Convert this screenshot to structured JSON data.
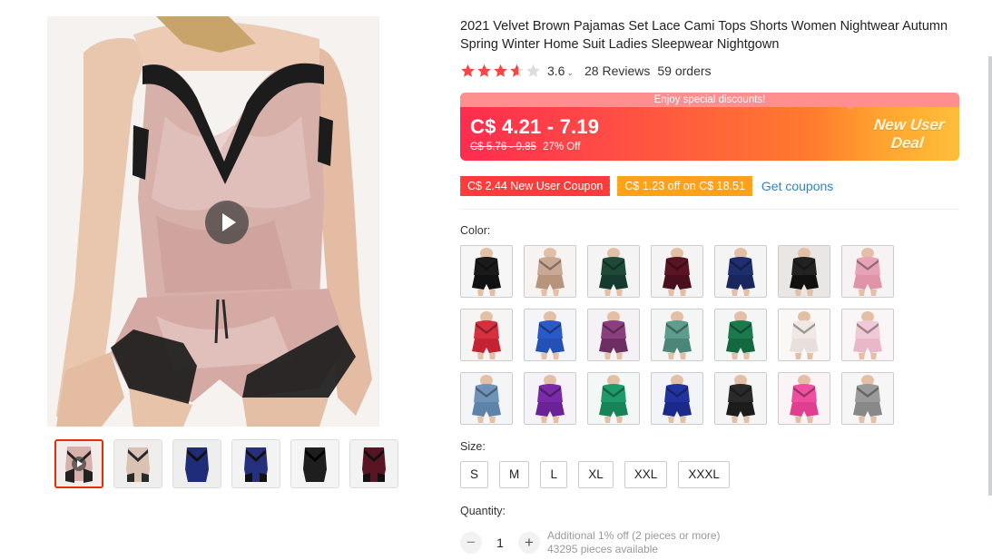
{
  "product": {
    "title": "2021 Velvet Brown Pajamas Set Lace Cami Tops Shorts Women Nightwear Autumn Spring Winter Home Suit Ladies Sleepwear Nightgown",
    "rating": {
      "value": "3.6",
      "stars": 3.6,
      "reviews": "28 Reviews",
      "orders": "59 orders"
    }
  },
  "price": {
    "banner": "Enjoy special discounts!",
    "range": "C$ 4.21 - 7.19",
    "original": "C$ 5.76 - 9.85",
    "discount": "27% Off",
    "deal_line1": "New User",
    "deal_line2": "Deal"
  },
  "coupons": {
    "new_user": "C$ 2.44 New User Coupon",
    "store": "C$ 1.23 off on C$ 18.51",
    "get": "Get coupons"
  },
  "color": {
    "label": "Color:",
    "swatches": [
      {
        "name": "black",
        "top": "#1a1a1a",
        "bottom": "#111111",
        "bg": "#f6f6f6"
      },
      {
        "name": "champagne",
        "top": "#c9a995",
        "bottom": "#b8947c",
        "bg": "#f6f3f0"
      },
      {
        "name": "dark-green",
        "top": "#1f4a3a",
        "bottom": "#163a2d",
        "bg": "#f4f4f4"
      },
      {
        "name": "wine",
        "top": "#5a1524",
        "bottom": "#4a0f1c",
        "bg": "#f4f4f4"
      },
      {
        "name": "navy",
        "top": "#1e2f6e",
        "bottom": "#18285e",
        "bg": "#f4f4f4"
      },
      {
        "name": "black-lace",
        "top": "#222222",
        "bottom": "#111111",
        "bg": "#e9e6e4"
      },
      {
        "name": "pink",
        "top": "#e7a4b6",
        "bottom": "#e094a8",
        "bg": "#f7f2f3"
      },
      {
        "name": "red",
        "top": "#d6303f",
        "bottom": "#c42334",
        "bg": "#f7f4f4"
      },
      {
        "name": "royal-blue",
        "top": "#2a5ac8",
        "bottom": "#2351b5",
        "bg": "#f4f5f8"
      },
      {
        "name": "purple-print",
        "top": "#8c3f7e",
        "bottom": "#6d2f63",
        "bg": "#f4f2f4"
      },
      {
        "name": "teal-print",
        "top": "#5e9c8e",
        "bottom": "#4c8678",
        "bg": "#f4f6f5"
      },
      {
        "name": "emerald",
        "top": "#1a7a4d",
        "bottom": "#146840",
        "bg": "#f4f6f5"
      },
      {
        "name": "white-print",
        "top": "#efe8e4",
        "bottom": "#e8dfdc",
        "bg": "#faf8f7"
      },
      {
        "name": "light-pink",
        "top": "#f0c9d6",
        "bottom": "#e8b8c8",
        "bg": "#faf6f7"
      },
      {
        "name": "steel-blue",
        "top": "#6f94b8",
        "bottom": "#5d83a8",
        "bg": "#f3f5f7"
      },
      {
        "name": "violet",
        "top": "#7a2ca8",
        "bottom": "#6a2294",
        "bg": "#f5f3f7"
      },
      {
        "name": "green",
        "top": "#1f9a6a",
        "bottom": "#178458",
        "bg": "#f3f7f5"
      },
      {
        "name": "deep-blue",
        "top": "#2233a0",
        "bottom": "#1b2a8a",
        "bg": "#f3f4f8"
      },
      {
        "name": "charcoal",
        "top": "#2a2a2a",
        "bottom": "#1c1c1c",
        "bg": "#f5f5f5"
      },
      {
        "name": "hot-pink",
        "top": "#f04fa0",
        "bottom": "#e03f90",
        "bg": "#faf4f7"
      },
      {
        "name": "grey",
        "top": "#9a9a9a",
        "bottom": "#888888",
        "bg": "#f6f6f6"
      }
    ]
  },
  "size": {
    "label": "Size:",
    "options": [
      "S",
      "M",
      "L",
      "XL",
      "XXL",
      "XXXL"
    ]
  },
  "quantity": {
    "label": "Quantity:",
    "value": "1",
    "minus": "−",
    "plus": "+",
    "discount_note": "Additional 1% off (2 pieces or more)",
    "available": "43295 pieces available"
  },
  "colors": {
    "accent": "#ff3b3b",
    "link": "#2e86c1",
    "star": "#f04848",
    "star_empty": "#dcdcdc"
  }
}
